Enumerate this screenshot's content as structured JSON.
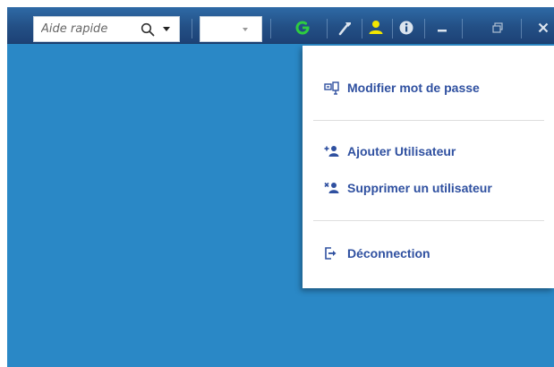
{
  "toolbar": {
    "search": {
      "placeholder": "Aide rapide",
      "value": ""
    },
    "combo": {
      "value": ""
    },
    "icons": [
      "refresh-icon",
      "tools-icon",
      "user-icon",
      "info-icon",
      "minimize-icon",
      "restore-icon",
      "close-icon"
    ],
    "colors": {
      "refresh": "#2ecc40",
      "user": "#f2e600",
      "icon": "#dbe4ee"
    }
  },
  "user_menu": {
    "items": [
      {
        "id": "change-password",
        "label": "Modifier mot de passe",
        "icon": "password-icon"
      },
      {
        "id": "add-user",
        "label": "Ajouter Utilisateur",
        "icon": "add-user-icon"
      },
      {
        "id": "delete-user",
        "label": "Supprimer un utilisateur",
        "icon": "delete-user-icon"
      },
      {
        "id": "logout",
        "label": "Déconnection",
        "icon": "logout-icon"
      }
    ]
  },
  "colors": {
    "workspace": "#2a88c6",
    "toolbar": "#234f85",
    "menu_text": "#2f50a0"
  }
}
